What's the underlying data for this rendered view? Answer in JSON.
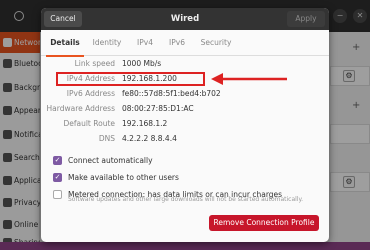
{
  "background": {
    "sidebar_items": [
      {
        "label": "Network",
        "active": true
      },
      {
        "label": "Bluetooth",
        "active": false
      },
      {
        "label": "Background",
        "active": false
      },
      {
        "label": "Appearance",
        "active": false
      },
      {
        "label": "Notifications",
        "active": false
      },
      {
        "label": "Search",
        "active": false
      },
      {
        "label": "Applications",
        "active": false
      },
      {
        "label": "Privacy",
        "active": false
      },
      {
        "label": "Online Accounts",
        "active": false
      },
      {
        "label": "Sharing",
        "active": false
      }
    ],
    "top_buttons": [
      "−",
      "✕"
    ],
    "gear_glyph": "⚙",
    "plus_glyph": "+"
  },
  "dialog": {
    "title": "Wired",
    "cancel_label": "Cancel",
    "apply_label": "Apply",
    "tabs": [
      "Details",
      "Identity",
      "IPv4",
      "IPv6",
      "Security"
    ],
    "active_tab": "Details",
    "details": [
      {
        "label": "Link speed",
        "value": "1000 Mb/s"
      },
      {
        "label": "IPv4 Address",
        "value": "192.168.1.200"
      },
      {
        "label": "IPv6 Address",
        "value": "fe80::57d8:5f1:bed4:b702"
      },
      {
        "label": "Hardware Address",
        "value": "08:00:27:85:D1:AC"
      },
      {
        "label": "Default Route",
        "value": "192.168.1.2"
      },
      {
        "label": "DNS",
        "value": "4.2.2.2 8.8.4.4"
      }
    ],
    "checkboxes": [
      {
        "label": "Connect automatically",
        "checked": true
      },
      {
        "label": "Make available to other users",
        "checked": true
      },
      {
        "label": "Metered connection: has data limits or can incur charges",
        "checked": false
      }
    ],
    "metered_subtext": "Software updates and other large downloads will not be started automatically.",
    "remove_label": "Remove Connection Profile"
  },
  "colors": {
    "accent": "#e95420",
    "checkbox": "#7e5aa3",
    "destructive": "#c7162b",
    "annotation": "#dd2222"
  }
}
